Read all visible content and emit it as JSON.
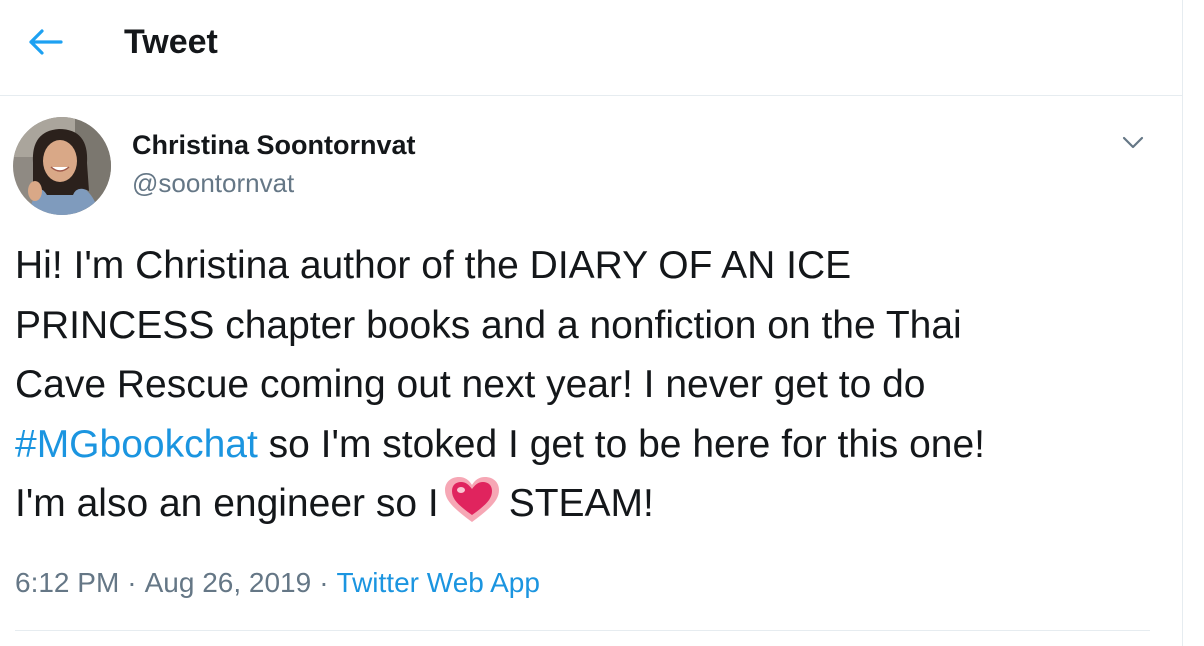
{
  "header": {
    "title": "Tweet",
    "back_icon": "arrow-left-icon"
  },
  "colors": {
    "accent": "#1da1f2",
    "link": "#1b95e0",
    "text": "#14171a",
    "secondary": "#657786",
    "border": "#e6ecf0"
  },
  "tweet": {
    "author": {
      "name": "Christina Soontornvat",
      "handle": "@soontornvat"
    },
    "text": {
      "line1": "Hi! I'm Christina author of the DIARY OF AN ICE",
      "line2": "PRINCESS chapter books and a nonfiction on the Thai",
      "line3": "Cave Rescue coming out next year! I never get to do",
      "hashtag": "#MGbookchat",
      "line4_rest": " so I'm stoked I get to be here for this one!",
      "line5_start": "I'm also an engineer so I",
      "emoji": "heart-emoji",
      "line5_end": "STEAM!"
    },
    "time": "6:12 PM",
    "separator": "·",
    "date": "Aug 26, 2019",
    "source": "Twitter Web App"
  }
}
